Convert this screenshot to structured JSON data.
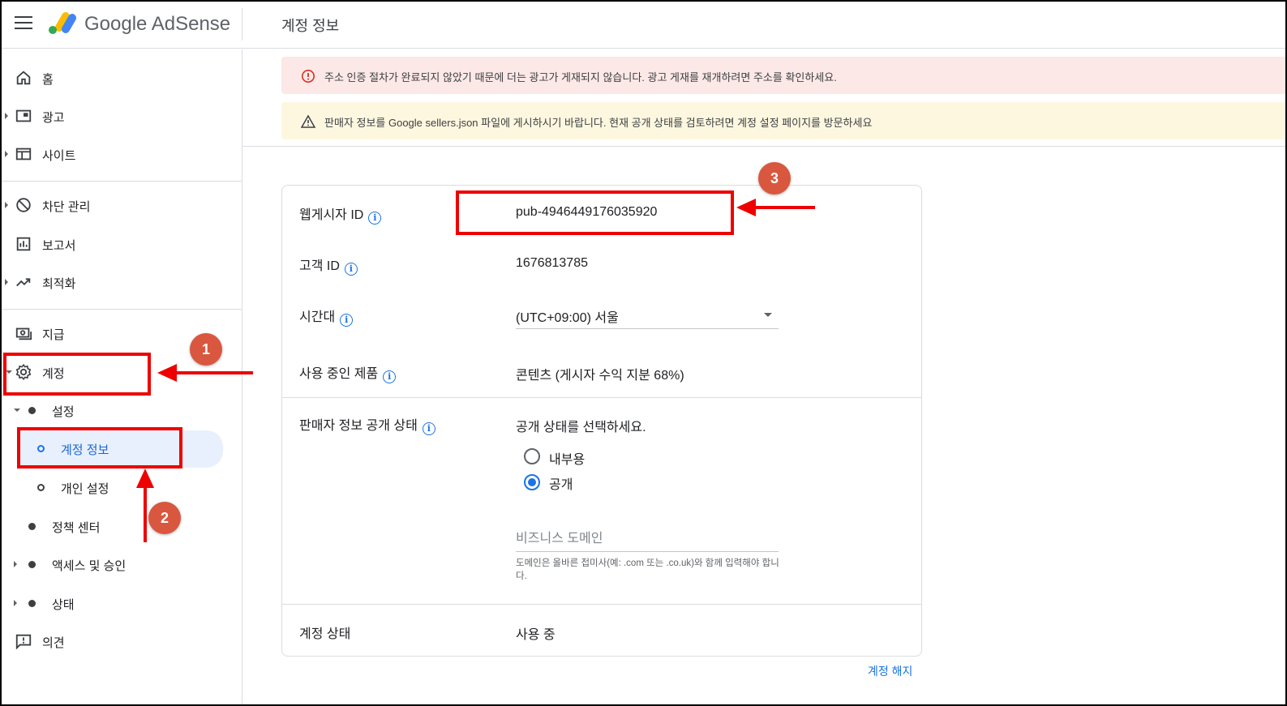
{
  "header": {
    "brand": "Google AdSense",
    "page_title": "계정 정보"
  },
  "sidebar": {
    "items": [
      {
        "label": "홈"
      },
      {
        "label": "광고"
      },
      {
        "label": "사이트"
      },
      {
        "label": "차단 관리"
      },
      {
        "label": "보고서"
      },
      {
        "label": "최적화"
      },
      {
        "label": "지급"
      },
      {
        "label": "계정"
      },
      {
        "label": "설정"
      },
      {
        "label": "계정 정보"
      },
      {
        "label": "개인 설정"
      },
      {
        "label": "정책 센터"
      },
      {
        "label": "액세스 및 승인"
      },
      {
        "label": "상태"
      },
      {
        "label": "의견"
      }
    ]
  },
  "banners": {
    "error": "주소 인증 절차가 완료되지 않았기 때문에 더는 광고가 게재되지 않습니다. 광고 게재를 재개하려면 주소를 확인하세요.",
    "warning": "판매자 정보를 Google sellers.json 파일에 게시하시기 바랍니다. 현재 공개 상태를 검토하려면 계정 설정 페이지를 방문하세요"
  },
  "account": {
    "publisher_id_label": "웹게시자 ID",
    "publisher_id": "pub-4946449176035920",
    "customer_id_label": "고객 ID",
    "customer_id": "1676813785",
    "timezone_label": "시간대",
    "timezone": "(UTC+09:00) 서울",
    "products_label": "사용 중인 제품",
    "products": "콘텐츠 (게시자 수익 지분 68%)",
    "seller_visibility_label": "판매자 정보 공개 상태",
    "seller_visibility_prompt": "공개 상태를 선택하세요.",
    "visibility_options": [
      "내부용",
      "공개"
    ],
    "visibility_selected": "공개",
    "domain_placeholder": "비즈니스 도메인",
    "domain_helper": "도메인은 올바른 접미사(예: .com 또는 .co.uk)와 함께 입력해야 합니다.",
    "status_label": "계정 상태",
    "status": "사용 중",
    "terminate_link": "계정 해지"
  },
  "annotations": {
    "badges": [
      "1",
      "2",
      "3"
    ]
  },
  "colors": {
    "accent": "#1a73e8",
    "annotation": "#ee0000",
    "badge": "#d9573e",
    "error_bg": "#fce8e6",
    "warning_bg": "#fef7e0"
  }
}
